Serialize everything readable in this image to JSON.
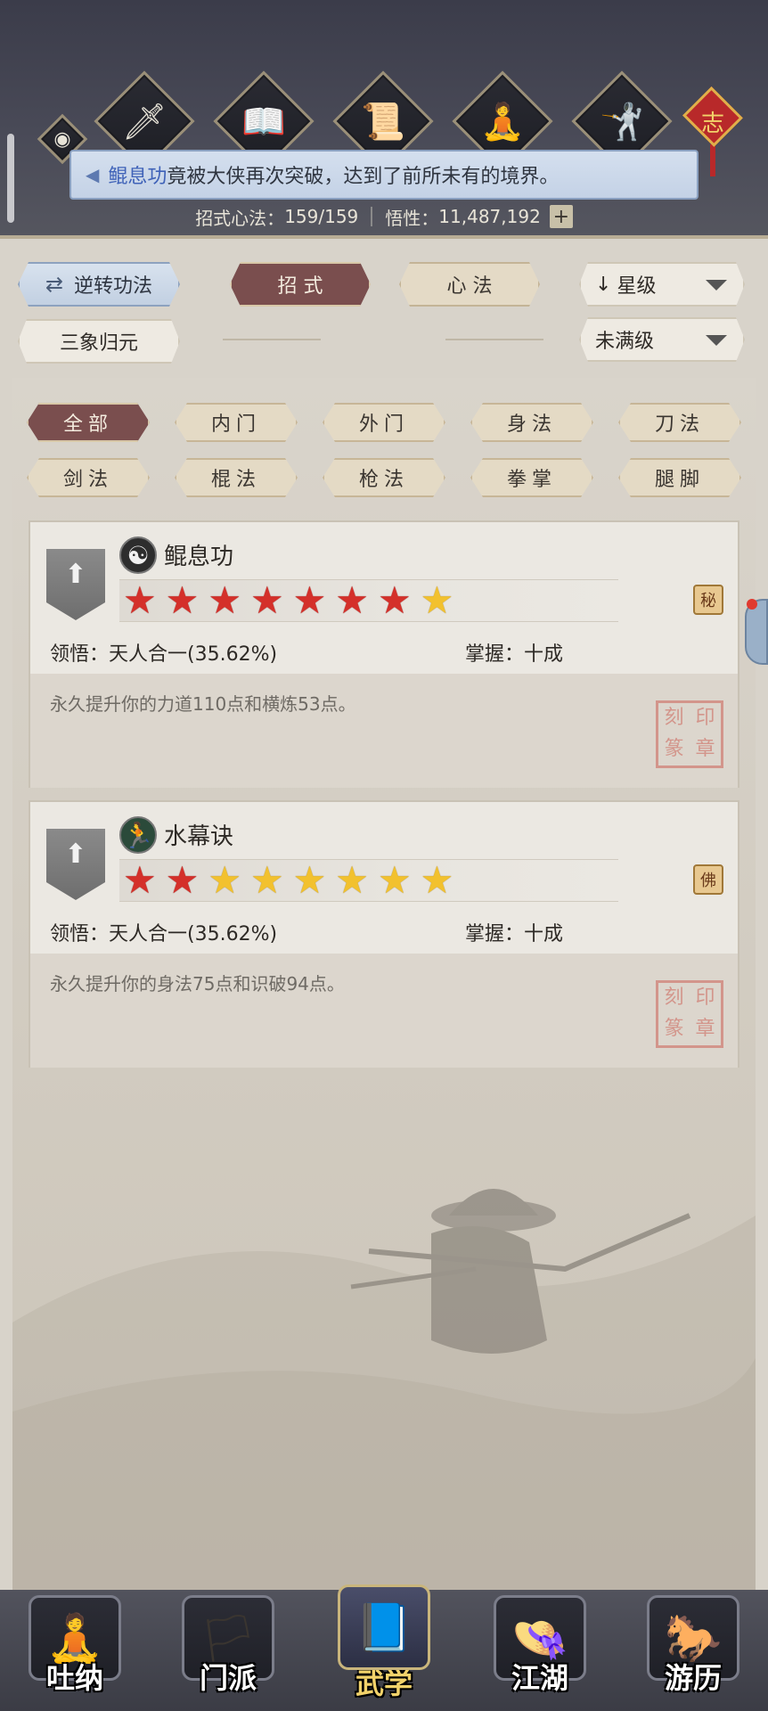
{
  "header": {
    "top_icons": [
      {
        "name": "sword-icon",
        "glyph": "🗡"
      },
      {
        "name": "book-icon",
        "glyph": "📖"
      },
      {
        "name": "scroll-bundle-icon",
        "glyph": "📜"
      },
      {
        "name": "meditation-icon",
        "glyph": "🧘"
      },
      {
        "name": "martial-stance-icon",
        "glyph": "🤺"
      }
    ],
    "knot_char": "志",
    "notice": {
      "highlight": "鲲息功",
      "text": "竟被大侠再次突破，达到了前所未有的境界。"
    },
    "stats": {
      "techniques_label": "招式心法：",
      "techniques_value": "159/159",
      "insight_label": "悟性：",
      "insight_value": "11,487,192",
      "plus": "+"
    }
  },
  "toolbar": {
    "reverse_label": "逆转功法",
    "tab_zhaoshi": "招 式",
    "tab_xinfa": "心 法",
    "sort_select": "星级",
    "sanxiang_label": "三象归元",
    "filter_select": "未满级"
  },
  "filters": [
    "全部",
    "内门",
    "外门",
    "身法",
    "刀法",
    "剑法",
    "棍法",
    "枪法",
    "拳掌",
    "腿脚"
  ],
  "filters_active_index": 0,
  "skills": [
    {
      "icon": "yin-yang-icon",
      "icon_glyph": "☯",
      "name": "鲲息功",
      "stars_red": 7,
      "stars_gold": 1,
      "comprehension_label": "领悟：",
      "comprehension_value": "天人合一(35.62%)",
      "mastery_label": "掌握：",
      "mastery_value": "十成",
      "description": "永久提升你的力道110点和横炼53点。",
      "scroll_glyph": "秘"
    },
    {
      "icon": "running-figure-icon",
      "icon_glyph": "🏃",
      "name": "水幕诀",
      "stars_red": 2,
      "stars_gold": 6,
      "comprehension_label": "领悟：",
      "comprehension_value": "天人合一(35.62%)",
      "mastery_label": "掌握：",
      "mastery_value": "十成",
      "description": "永久提升你的身法75点和识破94点。",
      "scroll_glyph": "佛"
    }
  ],
  "bottom_nav": [
    {
      "label": "吐纳",
      "icon": "monk-icon",
      "glyph": "🧘"
    },
    {
      "label": "门派",
      "icon": "sect-banner-icon",
      "glyph": "🏳"
    },
    {
      "label": "武学",
      "icon": "manual-book-icon",
      "glyph": "📘"
    },
    {
      "label": "江湖",
      "icon": "straw-hat-icon",
      "glyph": "👒"
    },
    {
      "label": "游历",
      "icon": "horse-icon",
      "glyph": "🐎"
    }
  ],
  "bottom_nav_active_index": 2,
  "colors": {
    "accent_active": "#7a4e4e",
    "star_red": "#d4302a",
    "star_gold": "#f2c12e",
    "notice_highlight": "#3f62b8"
  }
}
